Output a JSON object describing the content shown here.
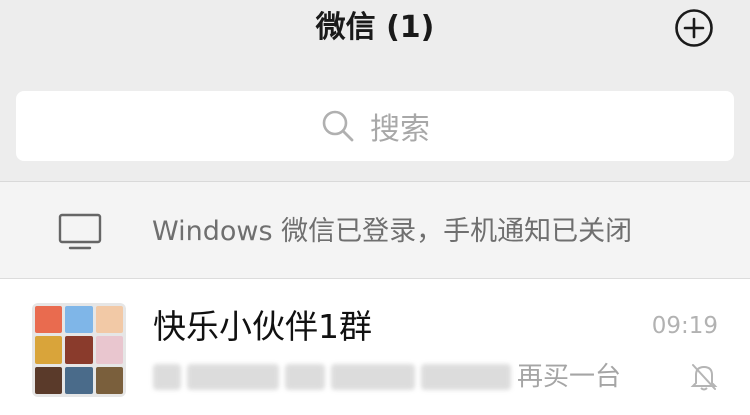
{
  "header": {
    "title": "微信 (1)",
    "add_icon": "plus-circle-icon"
  },
  "search": {
    "placeholder": "搜索",
    "icon": "search-icon"
  },
  "login_banner": {
    "icon": "monitor-icon",
    "text": "Windows 微信已登录，手机通知已关闭"
  },
  "chats": [
    {
      "name": "快乐小伙伴1群",
      "time": "09:19",
      "preview_visible": "再买一台",
      "muted": true,
      "mute_icon": "bell-off-icon",
      "avatar_colors": [
        "#e96b4f",
        "#7fb6e8",
        "#f2c9a6",
        "#d9a43a",
        "#8a3b2c",
        "#e9c6cf",
        "#5a3a2a",
        "#4a6b8a",
        "#7a5f3c"
      ]
    }
  ],
  "colors": {
    "background": "#ededed",
    "banner_background": "#f4f4f4",
    "row_background": "#ffffff",
    "secondary_text": "#a5a5a5"
  }
}
